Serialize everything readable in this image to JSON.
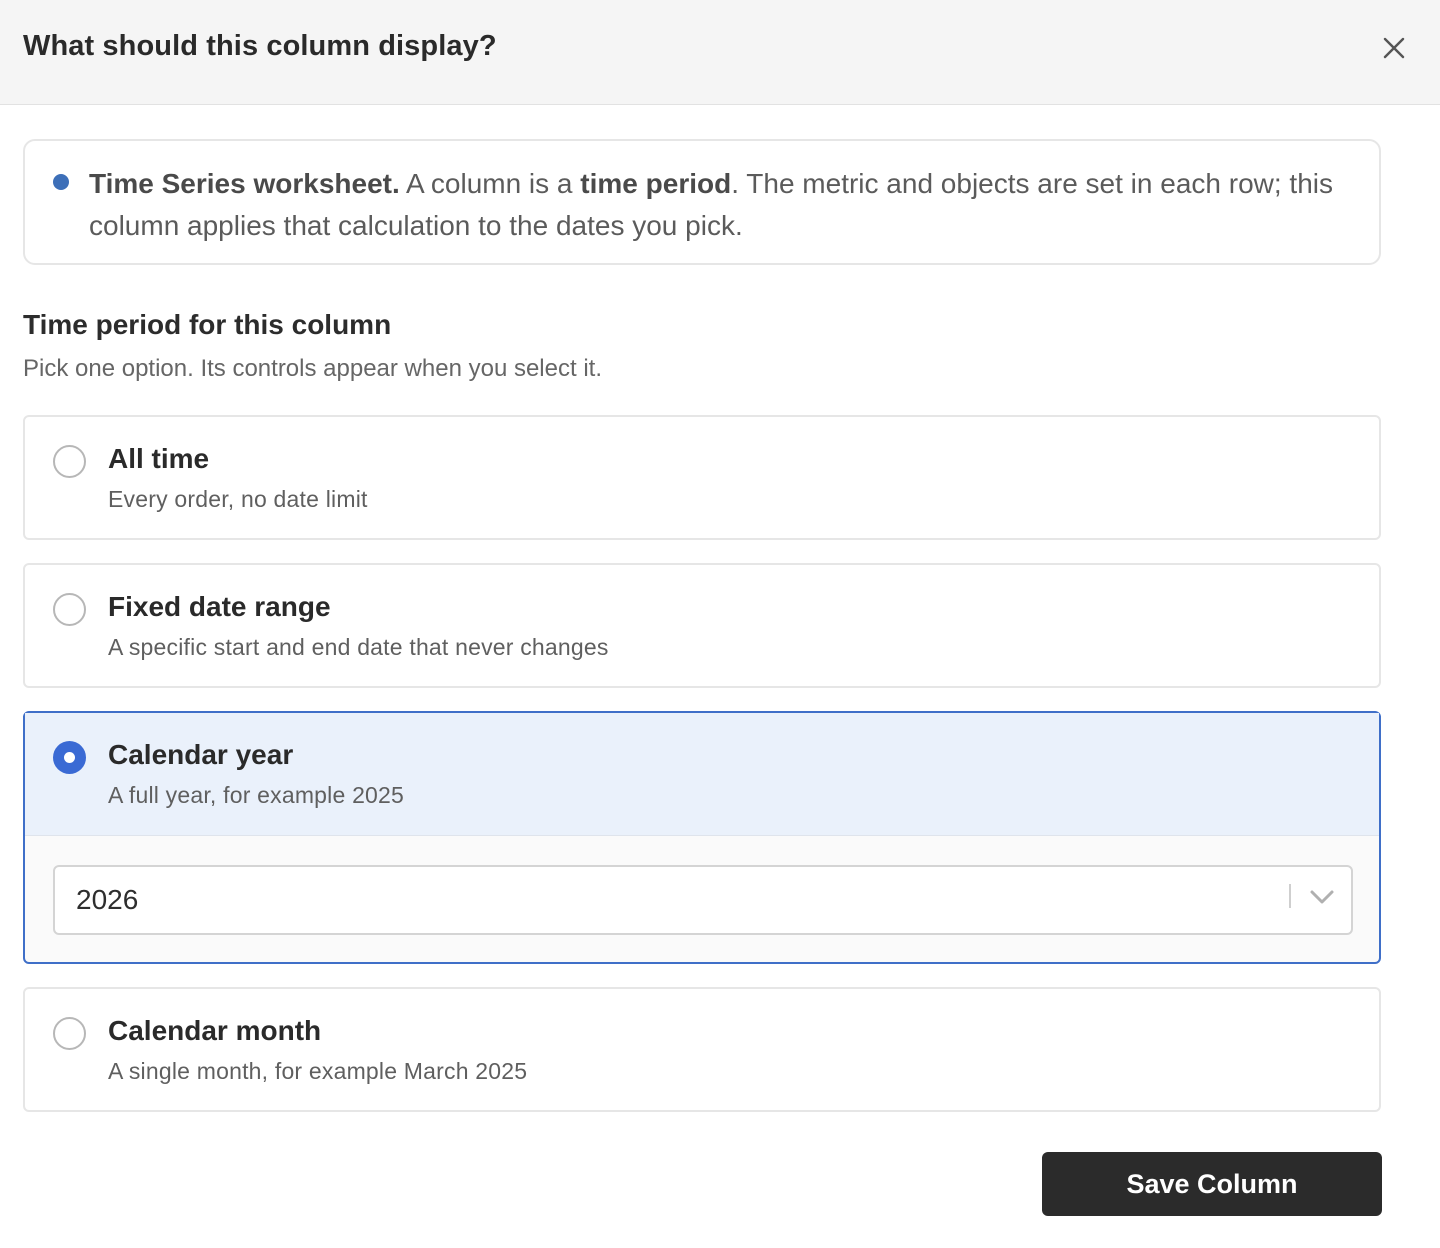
{
  "dialog": {
    "title": "What should this column display?",
    "close_icon": "close-icon"
  },
  "info": {
    "bold1": "Time Series worksheet.",
    "text1": " A column is a ",
    "bold2": "time period",
    "text2": ". The metric and objects are set in each row; this column applies that calculation to the dates you pick."
  },
  "section": {
    "title": "Time period for this column",
    "subtitle": "Pick one option. Its controls appear when you select it."
  },
  "options": [
    {
      "title": "All time",
      "description": "Every order, no date limit",
      "selected": false
    },
    {
      "title": "Fixed date range",
      "description": "A specific start and end date that never changes",
      "selected": false
    },
    {
      "title": "Calendar year",
      "description": "A full year, for example 2025",
      "selected": true
    },
    {
      "title": "Calendar month",
      "description": "A single month, for example March 2025",
      "selected": false
    }
  ],
  "year_select": {
    "value": "2026",
    "icon": "chevron-down-icon"
  },
  "footer": {
    "save_label": "Save Column"
  },
  "colors": {
    "accent": "#3a6ad4",
    "selected_bg": "#eaf1fb",
    "button_bg": "#2b2b2b"
  }
}
